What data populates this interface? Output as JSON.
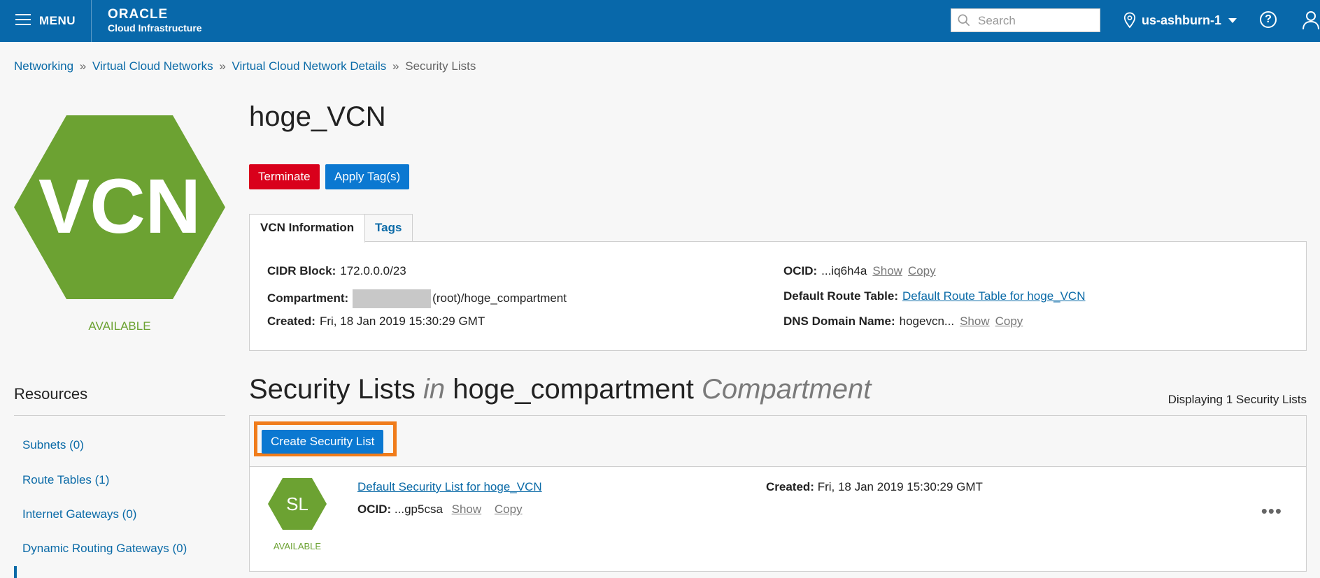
{
  "topbar": {
    "menu_label": "MENU",
    "logo_line1": "ORACLE",
    "logo_line2": "Cloud Infrastructure",
    "search_placeholder": "Search",
    "region": "us-ashburn-1",
    "help_glyph": "?"
  },
  "breadcrumb": {
    "items": [
      "Networking",
      "Virtual Cloud Networks",
      "Virtual Cloud Network Details"
    ],
    "separator": "»",
    "current": "Security Lists"
  },
  "vcn": {
    "icon_text": "VCN",
    "status": "AVAILABLE",
    "title": "hoge_VCN",
    "brand_color": "#6ca232"
  },
  "actions": {
    "terminate": "Terminate",
    "apply_tags": "Apply Tag(s)"
  },
  "tabs": {
    "info": "VCN Information",
    "tags": "Tags"
  },
  "info": {
    "cidr_label": "CIDR Block:",
    "cidr_value": "172.0.0.0/23",
    "compartment_label": "Compartment:",
    "compartment_value": "(root)/hoge_compartment",
    "created_label": "Created:",
    "created_value": "Fri, 18 Jan 2019 15:30:29 GMT",
    "ocid_label": "OCID:",
    "ocid_value": "...iq6h4a",
    "show": "Show",
    "copy": "Copy",
    "route_label": "Default Route Table:",
    "route_value": "Default Route Table for hoge_VCN",
    "dns_label": "DNS Domain Name:",
    "dns_value": "hogevcn..."
  },
  "resources": {
    "title": "Resources",
    "items": [
      "Subnets (0)",
      "Route Tables (1)",
      "Internet Gateways (0)",
      "Dynamic Routing Gateways (0)"
    ]
  },
  "security_lists": {
    "heading_main": "Security Lists",
    "heading_in": "in",
    "compartment": "hoge_compartment",
    "heading_suffix": "Compartment",
    "count_text": "Displaying 1 Security Lists",
    "create_button": "Create Security List",
    "rows": [
      {
        "icon_text": "SL",
        "name": "Default Security List for hoge_VCN",
        "ocid_label": "OCID:",
        "ocid_value": "...gp5csa",
        "show": "Show",
        "copy": "Copy",
        "created_label": "Created:",
        "created_value": "Fri, 18 Jan 2019 15:30:29 GMT",
        "status": "AVAILABLE",
        "more": "•••"
      }
    ]
  },
  "colors": {
    "header_bg": "#0868aa",
    "link": "#0a6aa7",
    "danger": "#d9001b",
    "primary": "#0b78d1",
    "highlight": "#f07c1b"
  }
}
